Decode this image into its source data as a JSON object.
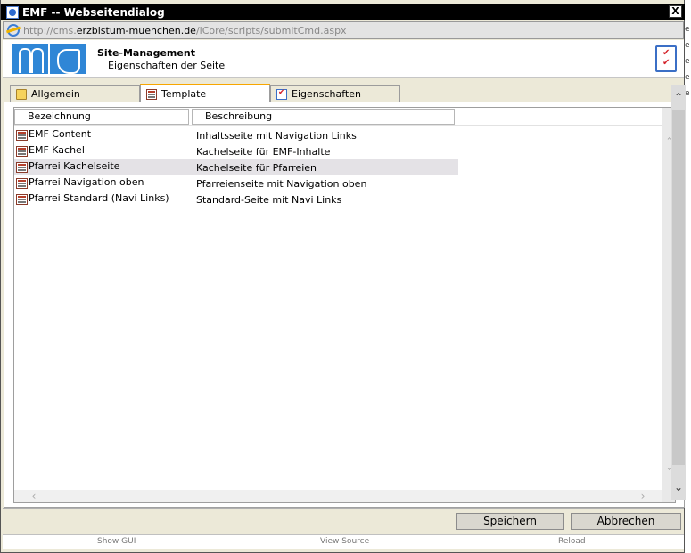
{
  "window": {
    "title": "EMF -- Webseitendialog",
    "close_glyph": "X"
  },
  "address": {
    "prefix": "http://cms.",
    "domain": "erzbistum-muenchen.de",
    "path": "/iCore/scripts/submitCmd.aspx"
  },
  "header": {
    "title": "Site-Management",
    "subtitle": "Eigenschaften der Seite"
  },
  "tabs": [
    {
      "label": "Allgemein",
      "icon": "folder-icon",
      "active": false
    },
    {
      "label": "Template",
      "icon": "template-icon",
      "active": true
    },
    {
      "label": "Eigenschaften",
      "icon": "properties-icon",
      "active": false
    }
  ],
  "table": {
    "columns": [
      "Bezeichnung",
      "Beschreibung"
    ],
    "rows": [
      {
        "name": "EMF Content",
        "description": "Inhaltsseite mit Navigation Links",
        "selected": false
      },
      {
        "name": "EMF Kachel",
        "description": "Kachelseite für EMF-Inhalte",
        "selected": false
      },
      {
        "name": "Pfarrei Kachelseite",
        "description": "Kachelseite für Pfarreien",
        "selected": true
      },
      {
        "name": "Pfarrei Navigation oben",
        "description": "Pfarreienseite mit Navigation oben",
        "selected": false
      },
      {
        "name": "Pfarrei Standard (Navi Links)",
        "description": "Standard-Seite mit Navi Links",
        "selected": false
      }
    ]
  },
  "buttons": {
    "save": "Speichern",
    "cancel": "Abbrechen"
  },
  "statusbar": {
    "show_gui": "Show GUI",
    "view_source": "View Source",
    "reload": "Reload"
  },
  "colors": {
    "titlebar": "#000000",
    "logo_blue": "#2f86d6",
    "active_tab_accent": "#f7a600",
    "selected_row": "#e4e2e6"
  }
}
